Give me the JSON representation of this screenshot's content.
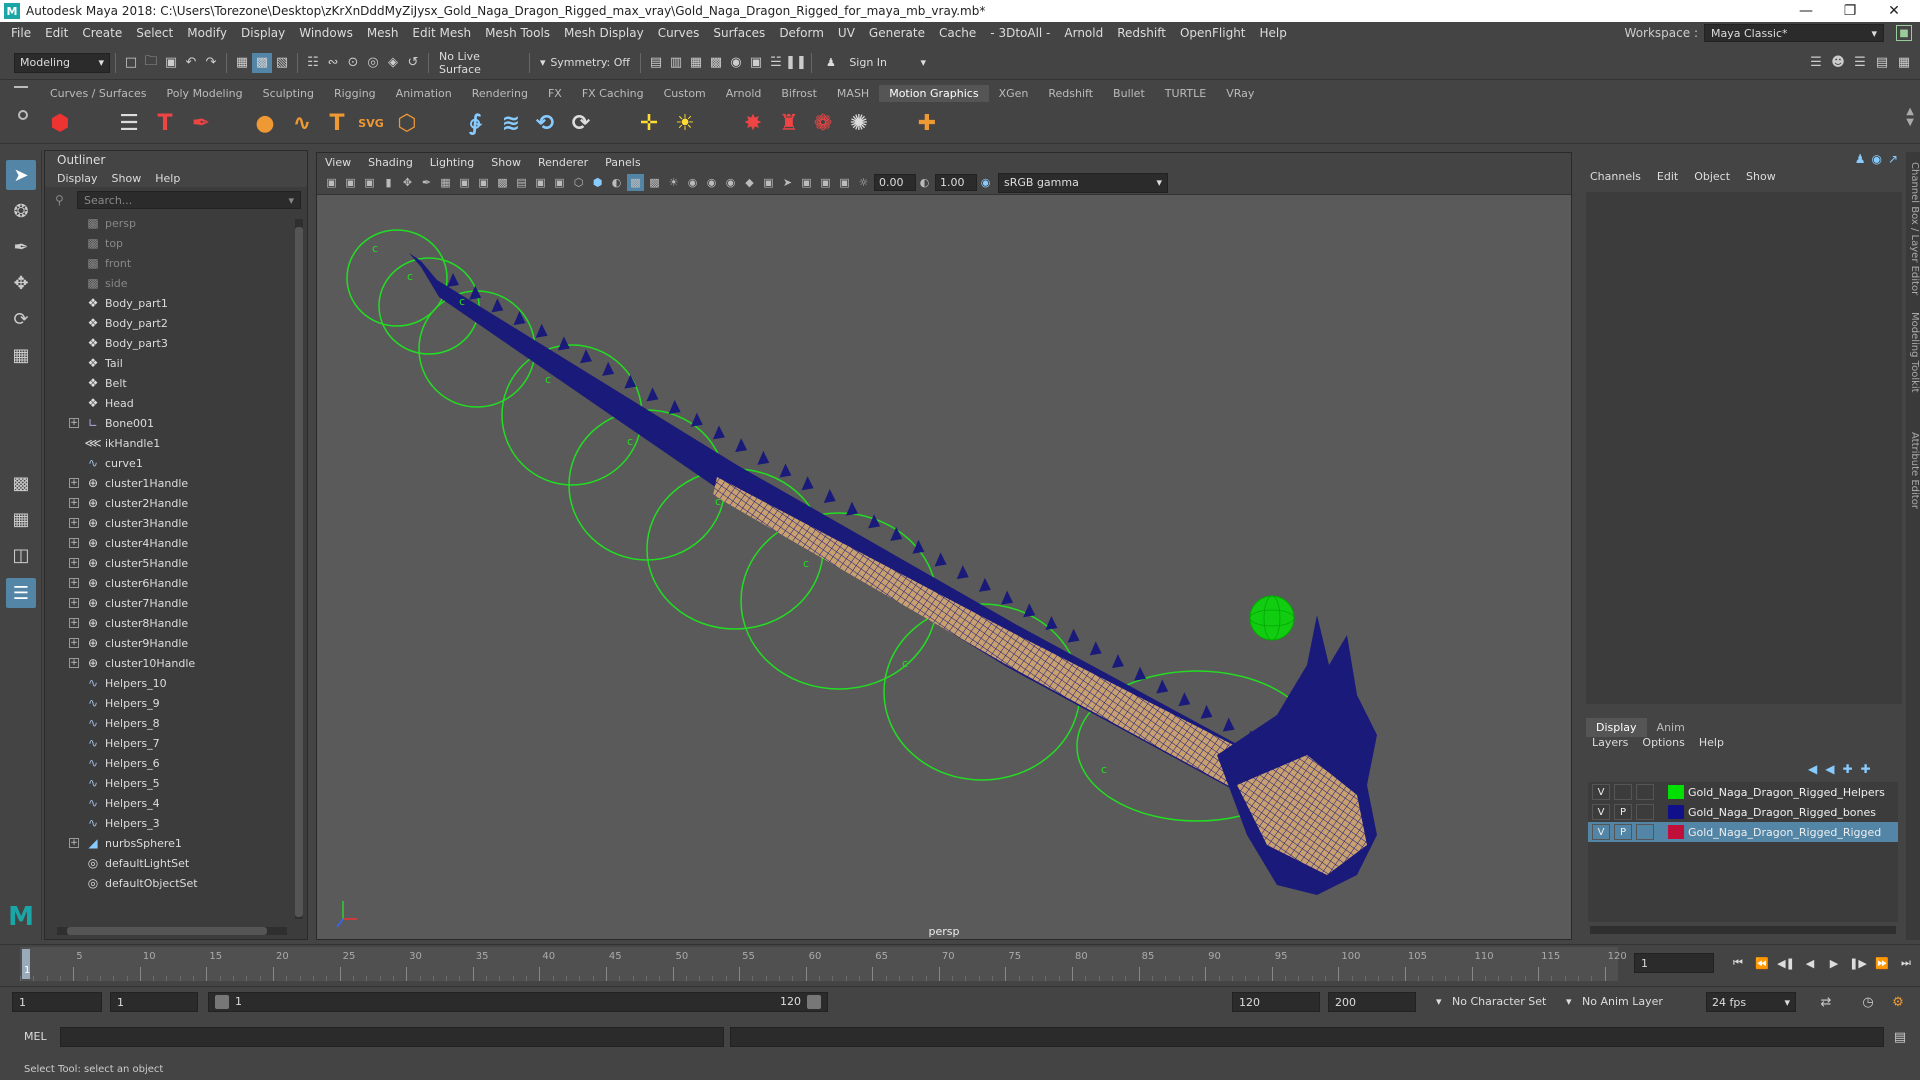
{
  "window": {
    "title": "Autodesk Maya 2018: C:\\Users\\Torezone\\Desktop\\zKrXnDddMyZiJysx_Gold_Naga_Dragon_Rigged_max_vray\\Gold_Naga_Dragon_Rigged_for_maya_mb_vray.mb*"
  },
  "menubar": {
    "items": [
      "File",
      "Edit",
      "Create",
      "Select",
      "Modify",
      "Display",
      "Windows",
      "Mesh",
      "Edit Mesh",
      "Mesh Tools",
      "Mesh Display",
      "Curves",
      "Surfaces",
      "Deform",
      "UV",
      "Generate",
      "Cache",
      "- 3DtoAll -",
      "Arnold",
      "Redshift",
      "OpenFlight",
      "Help"
    ],
    "workspace_label": "Workspace :",
    "workspace_value": "Maya Classic*"
  },
  "statusline": {
    "mode": "Modeling",
    "live_surface": "No Live Surface",
    "symmetry": "Symmetry: Off",
    "sign_in": "Sign In"
  },
  "shelf": {
    "tabs": [
      "Curves / Surfaces",
      "Poly Modeling",
      "Sculpting",
      "Rigging",
      "Animation",
      "Rendering",
      "FX",
      "FX Caching",
      "Custom",
      "Arnold",
      "Bifrost",
      "MASH",
      "Motion Graphics",
      "XGen",
      "Redshift",
      "Bullet",
      "TURTLE",
      "VRay"
    ],
    "active_tab": "Motion Graphics"
  },
  "outliner": {
    "title": "Outliner",
    "menus": [
      "Display",
      "Show",
      "Help"
    ],
    "search_placeholder": "Search...",
    "items": [
      {
        "label": "persp",
        "icon": "camera-icon",
        "dim": true,
        "expand": false
      },
      {
        "label": "top",
        "icon": "camera-icon",
        "dim": true,
        "expand": false
      },
      {
        "label": "front",
        "icon": "camera-icon",
        "dim": true,
        "expand": false
      },
      {
        "label": "side",
        "icon": "camera-icon",
        "dim": true,
        "expand": false
      },
      {
        "label": "Body_part1",
        "icon": "mesh-icon",
        "dim": false,
        "expand": false
      },
      {
        "label": "Body_part2",
        "icon": "mesh-icon",
        "dim": false,
        "expand": false
      },
      {
        "label": "Body_part3",
        "icon": "mesh-icon",
        "dim": false,
        "expand": false
      },
      {
        "label": "Tail",
        "icon": "mesh-icon",
        "dim": false,
        "expand": false
      },
      {
        "label": "Belt",
        "icon": "mesh-icon",
        "dim": false,
        "expand": false
      },
      {
        "label": "Head",
        "icon": "mesh-icon",
        "dim": false,
        "expand": false
      },
      {
        "label": "Bone001",
        "icon": "joint-icon",
        "dim": false,
        "expand": true
      },
      {
        "label": "ikHandle1",
        "icon": "ik-handle-icon",
        "dim": false,
        "expand": false
      },
      {
        "label": "curve1",
        "icon": "curve-icon",
        "dim": false,
        "expand": false
      },
      {
        "label": "cluster1Handle",
        "icon": "cluster-icon",
        "dim": false,
        "expand": true
      },
      {
        "label": "cluster2Handle",
        "icon": "cluster-icon",
        "dim": false,
        "expand": true
      },
      {
        "label": "cluster3Handle",
        "icon": "cluster-icon",
        "dim": false,
        "expand": true
      },
      {
        "label": "cluster4Handle",
        "icon": "cluster-icon",
        "dim": false,
        "expand": true
      },
      {
        "label": "cluster5Handle",
        "icon": "cluster-icon",
        "dim": false,
        "expand": true
      },
      {
        "label": "cluster6Handle",
        "icon": "cluster-icon",
        "dim": false,
        "expand": true
      },
      {
        "label": "cluster7Handle",
        "icon": "cluster-icon",
        "dim": false,
        "expand": true
      },
      {
        "label": "cluster8Handle",
        "icon": "cluster-icon",
        "dim": false,
        "expand": true
      },
      {
        "label": "cluster9Handle",
        "icon": "cluster-icon",
        "dim": false,
        "expand": true
      },
      {
        "label": "cluster10Handle",
        "icon": "cluster-icon",
        "dim": false,
        "expand": true
      },
      {
        "label": "Helpers_10",
        "icon": "curve-icon",
        "dim": false,
        "expand": false
      },
      {
        "label": "Helpers_9",
        "icon": "curve-icon",
        "dim": false,
        "expand": false
      },
      {
        "label": "Helpers_8",
        "icon": "curve-icon",
        "dim": false,
        "expand": false
      },
      {
        "label": "Helpers_7",
        "icon": "curve-icon",
        "dim": false,
        "expand": false
      },
      {
        "label": "Helpers_6",
        "icon": "curve-icon",
        "dim": false,
        "expand": false
      },
      {
        "label": "Helpers_5",
        "icon": "curve-icon",
        "dim": false,
        "expand": false
      },
      {
        "label": "Helpers_4",
        "icon": "curve-icon",
        "dim": false,
        "expand": false
      },
      {
        "label": "Helpers_3",
        "icon": "curve-icon",
        "dim": false,
        "expand": false
      },
      {
        "label": "nurbsSphere1",
        "icon": "nurbs-icon",
        "dim": false,
        "expand": true
      },
      {
        "label": "defaultLightSet",
        "icon": "set-icon",
        "dim": false,
        "expand": false
      },
      {
        "label": "defaultObjectSet",
        "icon": "set-icon",
        "dim": false,
        "expand": false
      }
    ]
  },
  "viewport": {
    "menus": [
      "View",
      "Shading",
      "Lighting",
      "Show",
      "Renderer",
      "Panels"
    ],
    "exposure": "0.00",
    "gamma": "1.00",
    "color_space": "sRGB gamma",
    "camera": "persp"
  },
  "channelbox": {
    "menus": [
      "Channels",
      "Edit",
      "Object",
      "Show"
    ],
    "layer_tabs": [
      "Display",
      "Anim"
    ],
    "active_layer_tab": "Display",
    "layer_menus": [
      "Layers",
      "Options",
      "Help"
    ],
    "layers": [
      {
        "v": "V",
        "p": "",
        "name": "Gold_Naga_Dragon_Rigged_Helpers",
        "color": "#00e000",
        "selected": false
      },
      {
        "v": "V",
        "p": "P",
        "name": "Gold_Naga_Dragon_Rigged_bones",
        "color": "#10108a",
        "selected": false
      },
      {
        "v": "V",
        "p": "P",
        "name": "Gold_Naga_Dragon_Rigged_Rigged",
        "color": "#c0103a",
        "selected": true
      }
    ]
  },
  "side_tabs": [
    "Channel Box / Layer Editor",
    "Modeling Toolkit",
    "Attribute Editor"
  ],
  "timeline": {
    "ticks": [
      "5",
      "10",
      "15",
      "20",
      "25",
      "30",
      "35",
      "40",
      "45",
      "50",
      "55",
      "60",
      "65",
      "70",
      "75",
      "80",
      "85",
      "90",
      "95",
      "100",
      "105",
      "110",
      "115",
      "120"
    ],
    "current_frame_marker": "1",
    "current_frame": "1"
  },
  "range": {
    "start": "1",
    "playback_start": "1",
    "slider_start": "1",
    "slider_end": "120",
    "playback_end": "120",
    "end": "200",
    "character_set": "No Character Set",
    "anim_layer": "No Anim Layer",
    "fps": "24 fps"
  },
  "cmdline": {
    "label": "MEL"
  },
  "helpline": {
    "text": "Select Tool: select an object"
  },
  "colors": {
    "accent": "#5285a6",
    "helper_green": "#22dd22",
    "mesh_navy": "#1a1a7a",
    "mesh_gold": "#c9a070"
  }
}
